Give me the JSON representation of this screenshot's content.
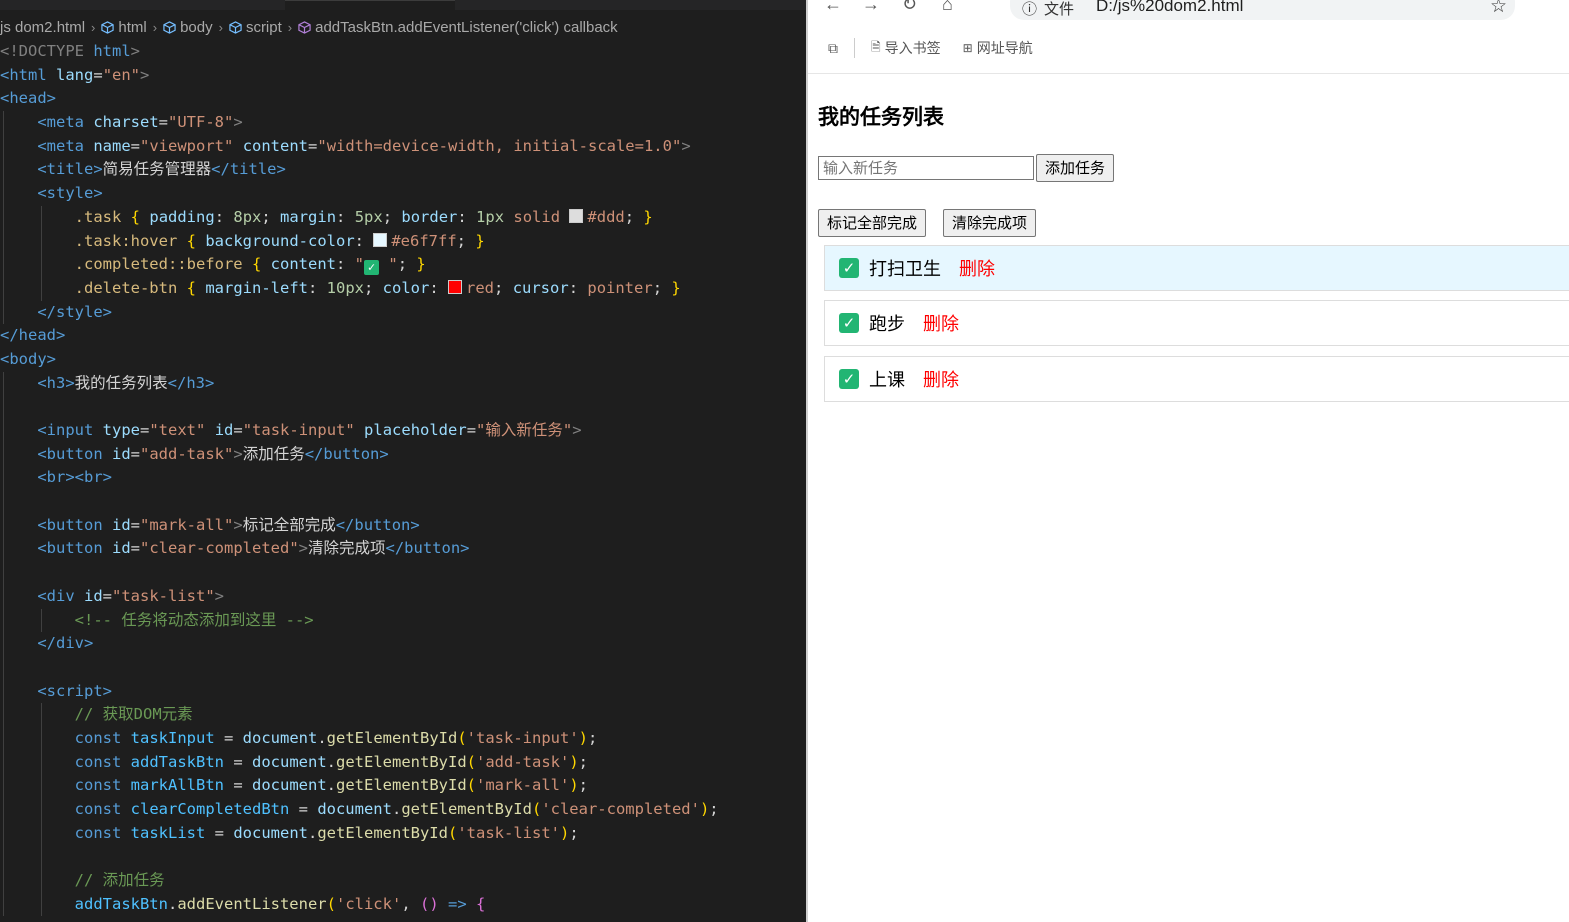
{
  "editor": {
    "breadcrumb": [
      "js dom2.html",
      "html",
      "body",
      "script",
      "addTaskBtn.addEventListener('click') callback"
    ],
    "code": {
      "l1_doctype": "<!DOCTYPE",
      "l1_html": "html",
      "l2_tag": "<html",
      "l2_attr": "lang",
      "l2_val": "\"en\"",
      "l3": "<head>",
      "l4_tag": "<meta",
      "l4_attr": "charset",
      "l4_val": "\"UTF-8\"",
      "l5_tag": "<meta",
      "l5_attr1": "name",
      "l5_val1": "\"viewport\"",
      "l5_attr2": "content",
      "l5_val2": "\"width=device-width, initial-scale=1.0\"",
      "l6_open": "<title>",
      "l6_text": "简易任务管理器",
      "l6_close": "</title>",
      "l7": "<style>",
      "l8_sel": ".task",
      "l8_prop1": "padding",
      "l8_num1": "8px",
      "l8_prop2": "margin",
      "l8_num2": "5px",
      "l8_prop3": "border",
      "l8_num3": "1px",
      "l8_kw": "solid",
      "l8_color": "#ddd",
      "l9_sel": ".task:hover",
      "l9_prop": "background-color",
      "l9_color": "#e6f7ff",
      "l10_sel": ".completed::before",
      "l10_prop": "content",
      "l11_sel": ".delete-btn",
      "l11_prop1": "margin-left",
      "l11_num": "10px",
      "l11_prop2": "color",
      "l11_color": "red",
      "l11_prop3": "cursor",
      "l11_val3": "pointer",
      "l12": "</style>",
      "l13": "</head>",
      "l14": "<body>",
      "l15_open": "<h3>",
      "l15_text": "我的任务列表",
      "l15_close": "</h3>",
      "l17_tag": "<input",
      "l17_a1": "type",
      "l17_v1": "\"text\"",
      "l17_a2": "id",
      "l17_v2": "\"task-input\"",
      "l17_a3": "placeholder",
      "l17_v3": "\"输入新任务\"",
      "l18_tag": "<button",
      "l18_a": "id",
      "l18_v": "\"add-task\"",
      "l18_text": "添加任务",
      "l18_close": "</button>",
      "l19": "<br><br>",
      "l21_tag": "<button",
      "l21_a": "id",
      "l21_v": "\"mark-all\"",
      "l21_text": "标记全部完成",
      "l21_close": "</button>",
      "l22_tag": "<button",
      "l22_a": "id",
      "l22_v": "\"clear-completed\"",
      "l22_text": "清除完成项",
      "l22_close": "</button>",
      "l24_tag": "<div",
      "l24_a": "id",
      "l24_v": "\"task-list\"",
      "l25": "<!-- 任务将动态添加到这里 -->",
      "l26": "</div>",
      "l28": "<script>",
      "l29": "// 获取DOM元素",
      "l30_var": "taskInput",
      "l30_id": "'task-input'",
      "l31_var": "addTaskBtn",
      "l31_id": "'add-task'",
      "l32_var": "markAllBtn",
      "l32_id": "'mark-all'",
      "l33_var": "clearCompletedBtn",
      "l33_id": "'clear-completed'",
      "l34_var": "taskList",
      "l34_id": "'task-list'",
      "l36": "// 添加任务",
      "l37_var": "addTaskBtn",
      "l37_fn": "addEventListener",
      "l37_str": "'click'",
      "kw_const": "const",
      "doc": "document",
      "get_fn": "getElementById"
    }
  },
  "browser": {
    "address": {
      "file_label": "文件",
      "url": "D:/js%20dom2.html"
    },
    "bookmarks": [
      "导入书签",
      "网址导航"
    ],
    "page": {
      "heading": "我的任务列表",
      "input_placeholder": "输入新任务",
      "add_button": "添加任务",
      "mark_all_button": "标记全部完成",
      "clear_button": "清除完成项",
      "delete_label": "删除",
      "tasks": [
        {
          "text": "打扫卫生",
          "completed": true,
          "hover": true
        },
        {
          "text": "跑步",
          "completed": true,
          "hover": false
        },
        {
          "text": "上课",
          "completed": true,
          "hover": false
        }
      ]
    }
  },
  "colors": {
    "editor_bg": "#1e1e1e",
    "hover_bg": "#e6f7ff",
    "delete_red": "#ff0000",
    "check_green": "#22b573"
  }
}
